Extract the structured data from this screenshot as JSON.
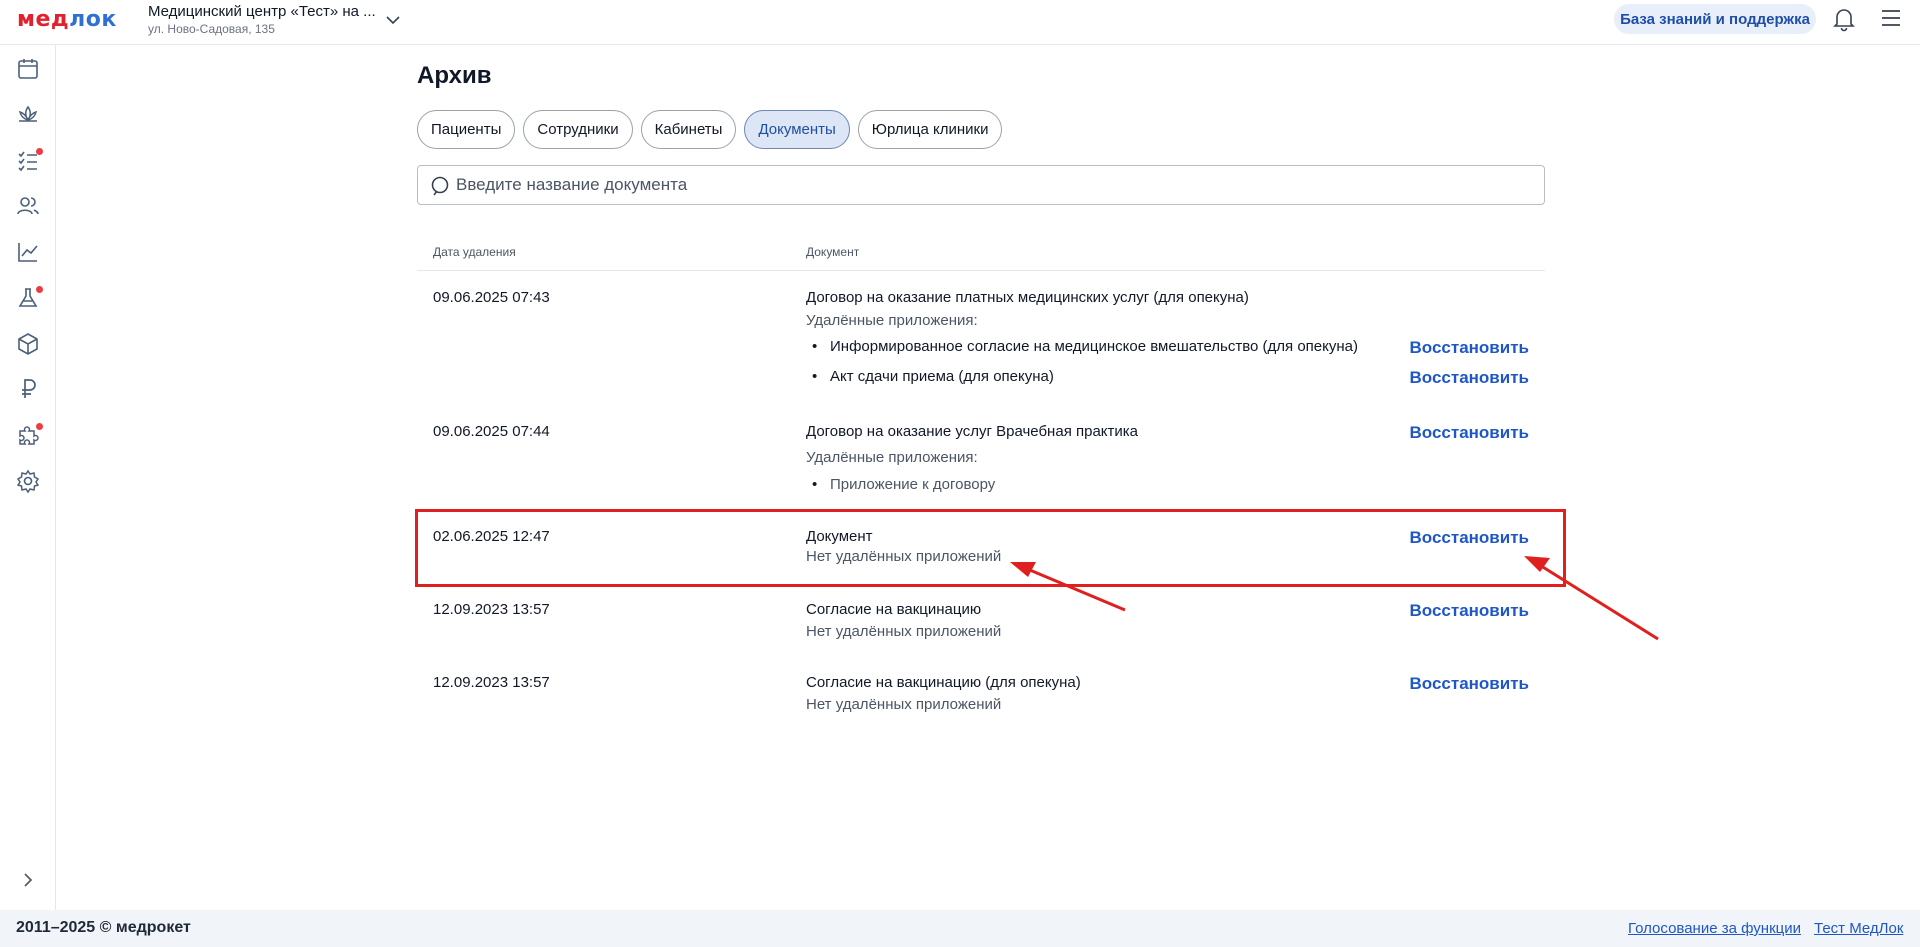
{
  "header": {
    "logo": {
      "part1": "мед",
      "part2": "лок"
    },
    "clinic_name": "Медицинский центр «Тест» на ...",
    "clinic_address": "ул. Ново-Садовая, 135",
    "kb_label": "База знаний и поддержка"
  },
  "sidebar": {
    "icons": [
      "calendar-icon",
      "lotus-icon",
      "checklist-icon",
      "users-icon",
      "chart-icon",
      "flask-icon",
      "box-icon",
      "ruble-icon",
      "puzzle-icon",
      "gear-icon"
    ],
    "badges": [
      "checklist-icon",
      "flask-icon",
      "puzzle-icon"
    ]
  },
  "page": {
    "title": "Архив",
    "tabs": [
      {
        "label": "Пациенты",
        "active": false
      },
      {
        "label": "Сотрудники",
        "active": false
      },
      {
        "label": "Кабинеты",
        "active": false
      },
      {
        "label": "Документы",
        "active": true
      },
      {
        "label": "Юрлица клиники",
        "active": false
      }
    ],
    "search_placeholder": "Введите название документа"
  },
  "table": {
    "col_date": "Дата удаления",
    "col_doc": "Документ",
    "restore_label": "Восстановить",
    "rows": [
      {
        "date": "09.06.2025 07:43",
        "document": "Договор на оказание платных медицинских услуг (для опекуна)",
        "attachments_label": "Удалённые приложения:",
        "attachments": [
          "Информированное согласие на медицинское вмешательство (для опекуна)",
          "Акт сдачи приема (для опекуна)"
        ]
      },
      {
        "date": "09.06.2025 07:44",
        "document": "Договор на оказание услуг Врачебная практика",
        "attachments_label": "Удалённые приложения:",
        "attachments": [
          "Приложение к договору"
        ]
      },
      {
        "date": "02.06.2025 12:47",
        "document": "Документ",
        "no_attachments": "Нет удалённых приложений"
      },
      {
        "date": "12.09.2023 13:57",
        "document": "Согласие на вакцинацию",
        "no_attachments": "Нет удалённых приложений"
      },
      {
        "date": "12.09.2023 13:57",
        "document": "Согласие на вакцинацию (для опекуна)",
        "no_attachments": "Нет удалённых приложений"
      }
    ]
  },
  "footer": {
    "copyright": "2011–2025 © медрокет",
    "link_vote": "Голосование за функции",
    "link_test": "Тест МедЛок"
  },
  "colors": {
    "accent": "#1f57c5",
    "brand_red": "#e1222e",
    "annotation": "#e0201e"
  }
}
